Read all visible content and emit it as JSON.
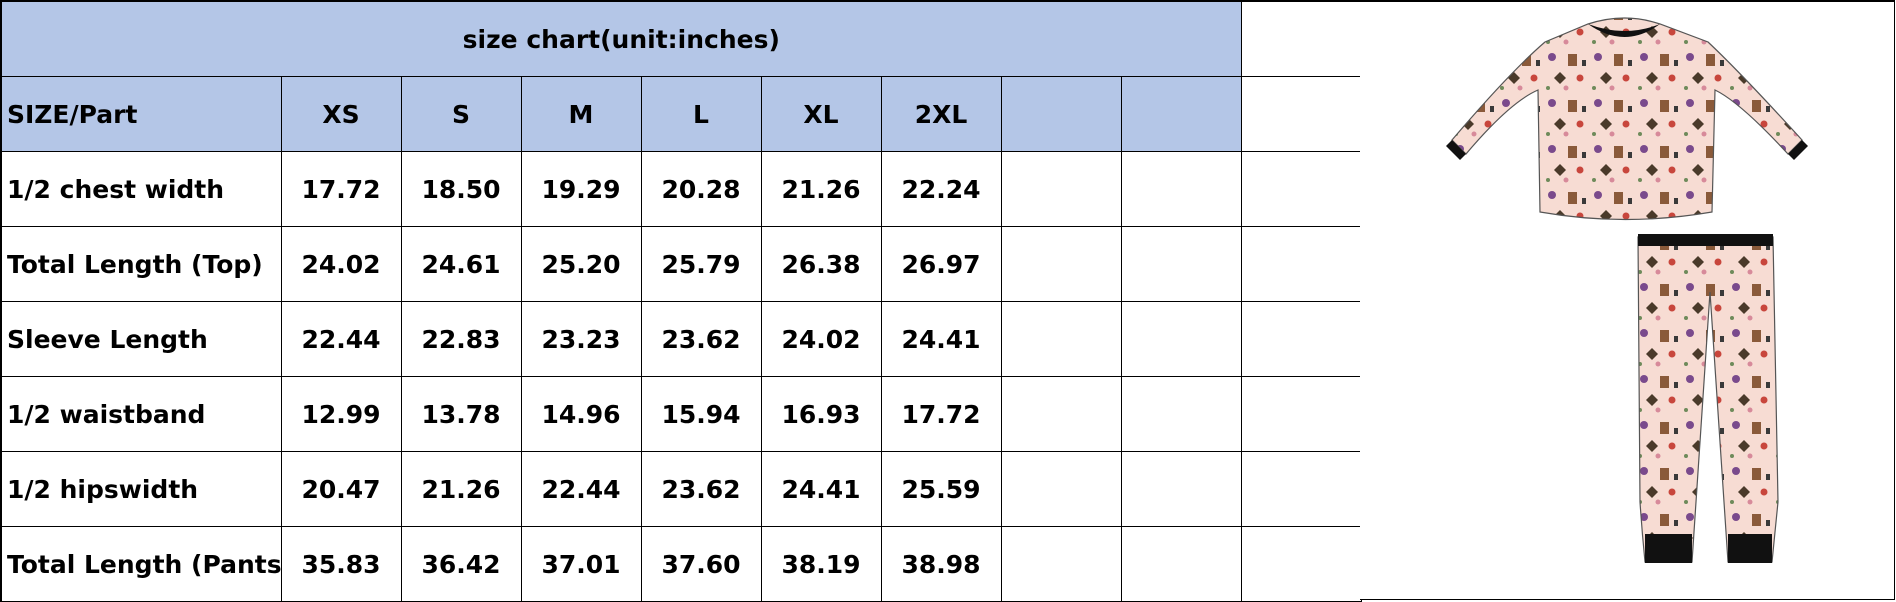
{
  "title": "size chart(unit:inches)",
  "header": {
    "part_label": "SIZE/Part",
    "sizes": [
      "XS",
      "S",
      "M",
      "L",
      "XL",
      "2XL"
    ]
  },
  "rows": [
    {
      "label": "1/2 chest width",
      "values": [
        "17.72",
        "18.50",
        "19.29",
        "20.28",
        "21.26",
        "22.24"
      ]
    },
    {
      "label": "Total Length (Top)",
      "values": [
        "24.02",
        "24.61",
        "25.20",
        "25.79",
        "26.38",
        "26.97"
      ]
    },
    {
      "label": "Sleeve Length",
      "values": [
        "22.44",
        "22.83",
        "23.23",
        "23.62",
        "24.02",
        "24.41"
      ]
    },
    {
      "label": "1/2 waistband",
      "values": [
        "12.99",
        "13.78",
        "14.96",
        "15.94",
        "16.93",
        "17.72"
      ]
    },
    {
      "label": "1/2 hipswidth",
      "values": [
        "20.47",
        "21.26",
        "22.44",
        "23.62",
        "24.41",
        "25.59"
      ]
    },
    {
      "label": "Total Length (Pants)",
      "values": [
        "35.83",
        "36.42",
        "37.01",
        "37.60",
        "38.19",
        "38.98"
      ]
    }
  ],
  "colors": {
    "header_fill": "#b4c6e7",
    "fabric": "#f7dcd3",
    "trim": "#111111"
  }
}
